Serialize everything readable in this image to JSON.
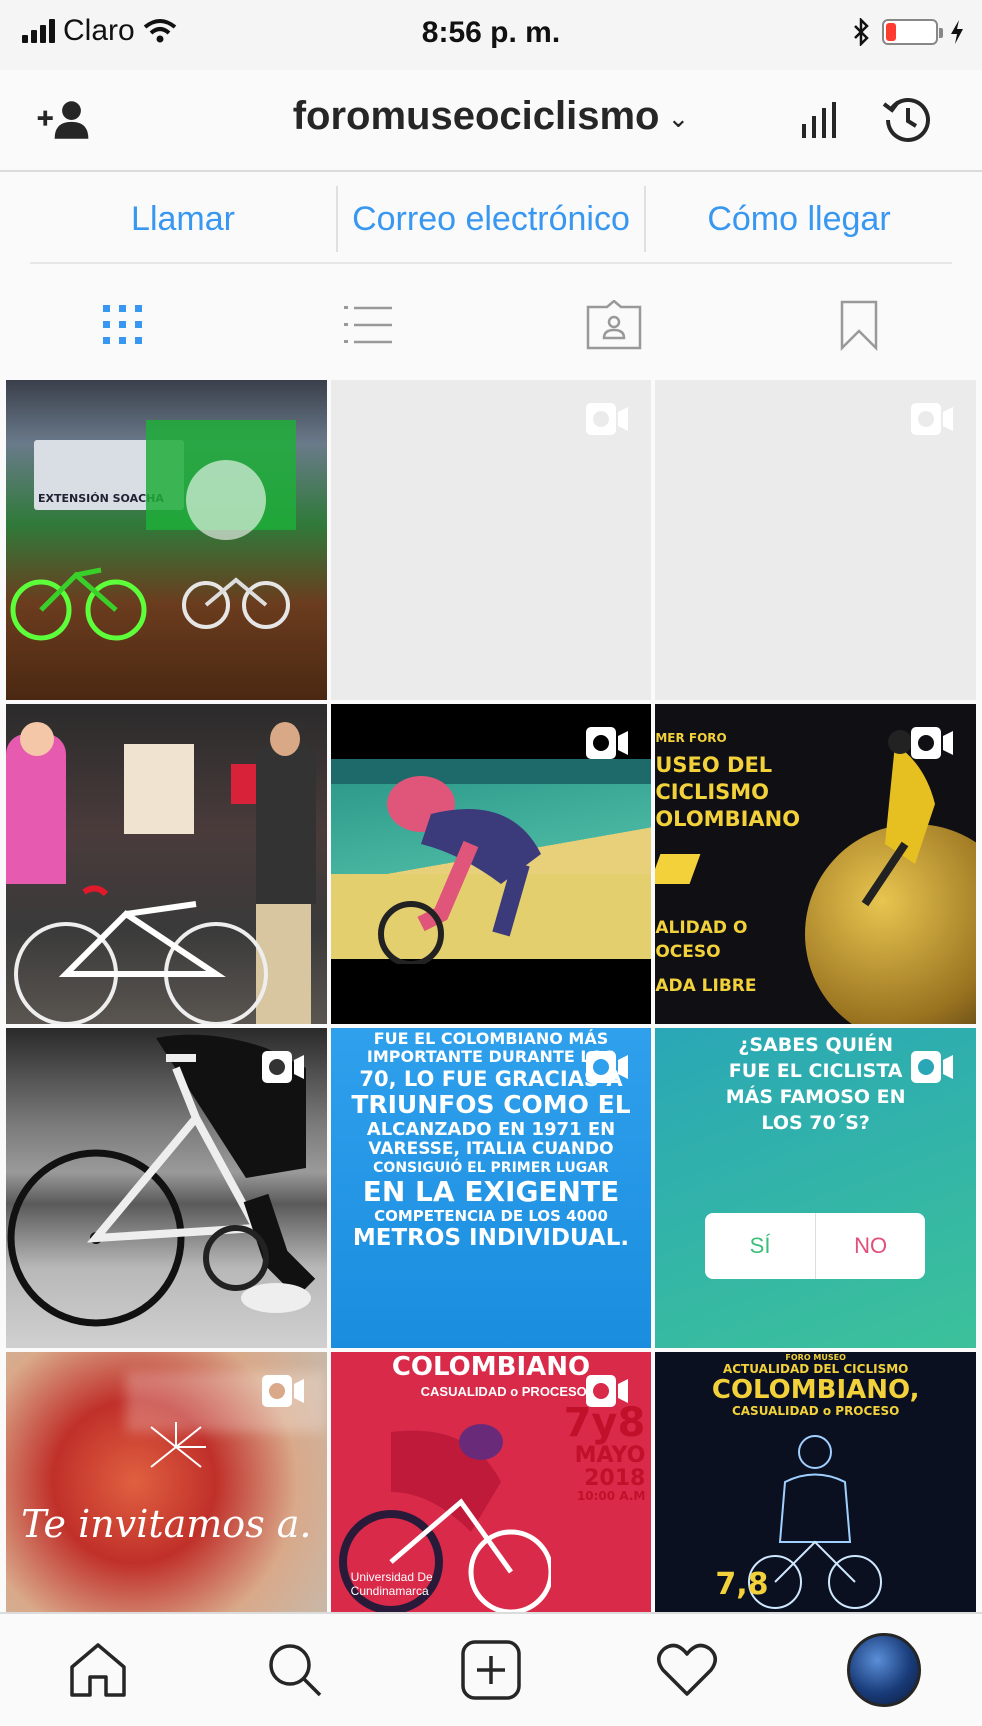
{
  "status_bar": {
    "carrier": "Claro",
    "time": "8:56 p. m.",
    "battery_level": 0.2
  },
  "header": {
    "username": "foromuseociclismo",
    "chevron": "⌄",
    "icons": [
      "add-user-icon",
      "insights-icon",
      "archive-history-icon"
    ]
  },
  "contact_actions": [
    {
      "label": "Llamar"
    },
    {
      "label": "Correo electrónico"
    },
    {
      "label": "Cómo llegar"
    }
  ],
  "view_tabs": [
    "grid-icon",
    "list-icon",
    "tagged-icon",
    "saved-icon"
  ],
  "posts": {
    "p1": {
      "text": "EXTENSIÓN SOACHA"
    },
    "p6": {
      "line1": "MER FORO",
      "line2": "USEO DEL",
      "line3": "CICLISMO",
      "line4": "OLOMBIANO",
      "line5": "ALIDAD O",
      "line6": "OCESO",
      "line7": "ADA LIBRE"
    },
    "p8": {
      "line1": "FUE EL COLOMBIANO MÁS",
      "line2": "IMPORTANTE DURANTE LOS",
      "line3": "70, LO FUE GRACIAS A",
      "line4": "TRIUNFOS COMO EL",
      "line5": "ALCANZADO EN 1971 EN",
      "line6": "VARESSE, ITALIA CUANDO",
      "line7": "CONSIGUIÓ EL PRIMER LUGAR",
      "line8": "EN LA EXIGENTE",
      "line9": "COMPETENCIA DE LOS 4000",
      "line10": "METROS INDIVIDUAL."
    },
    "p9": {
      "line1": "¿SABES QUIÉN",
      "line2": "FUE EL CICLISTA",
      "line3": "MÁS FAMOSO EN",
      "line4": "LOS 70´S?",
      "yes": "SÍ",
      "no": "NO"
    },
    "p10": {
      "text": "Te invitamos a."
    },
    "p11": {
      "title": "COLOMBIANO",
      "sub": "CASUALIDAD o PROCESO",
      "date1": "7y8",
      "date2": "MAYO",
      "date3": "2018",
      "date4": "10:00 A.M",
      "footer": "Universidad De Cundinamarca"
    },
    "p12": {
      "small": "FORO MUSEO",
      "line1": "ACTUALIDAD DEL CICLISMO",
      "line2": "COLOMBIANO,",
      "line3": "CASUALIDAD o PROCESO",
      "date": "7,8"
    }
  },
  "tab_bar": [
    "home-icon",
    "search-icon",
    "new-post-icon",
    "activity-heart-icon",
    "profile-avatar"
  ]
}
